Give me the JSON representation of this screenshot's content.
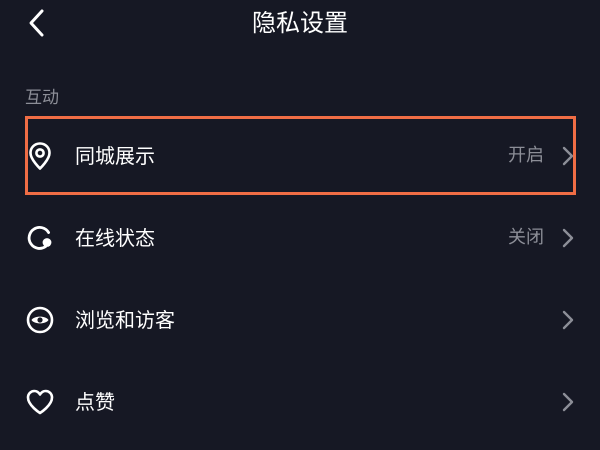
{
  "header": {
    "title": "隐私设置",
    "back_icon": "back-chevron-icon"
  },
  "section": {
    "label": "互动"
  },
  "items": [
    {
      "label": "同城展示",
      "value": "开启",
      "icon": "location-pin-icon",
      "highlighted": true
    },
    {
      "label": "在线状态",
      "value": "关闭",
      "icon": "online-status-icon"
    },
    {
      "label": "浏览和访客",
      "value": "",
      "icon": "eye-icon"
    },
    {
      "label": "点赞",
      "value": "",
      "icon": "heart-icon"
    }
  ],
  "colors": {
    "background": "#161824",
    "text_primary": "#ffffff",
    "text_secondary": "#8c8e97",
    "highlight": "#ef6d45"
  }
}
